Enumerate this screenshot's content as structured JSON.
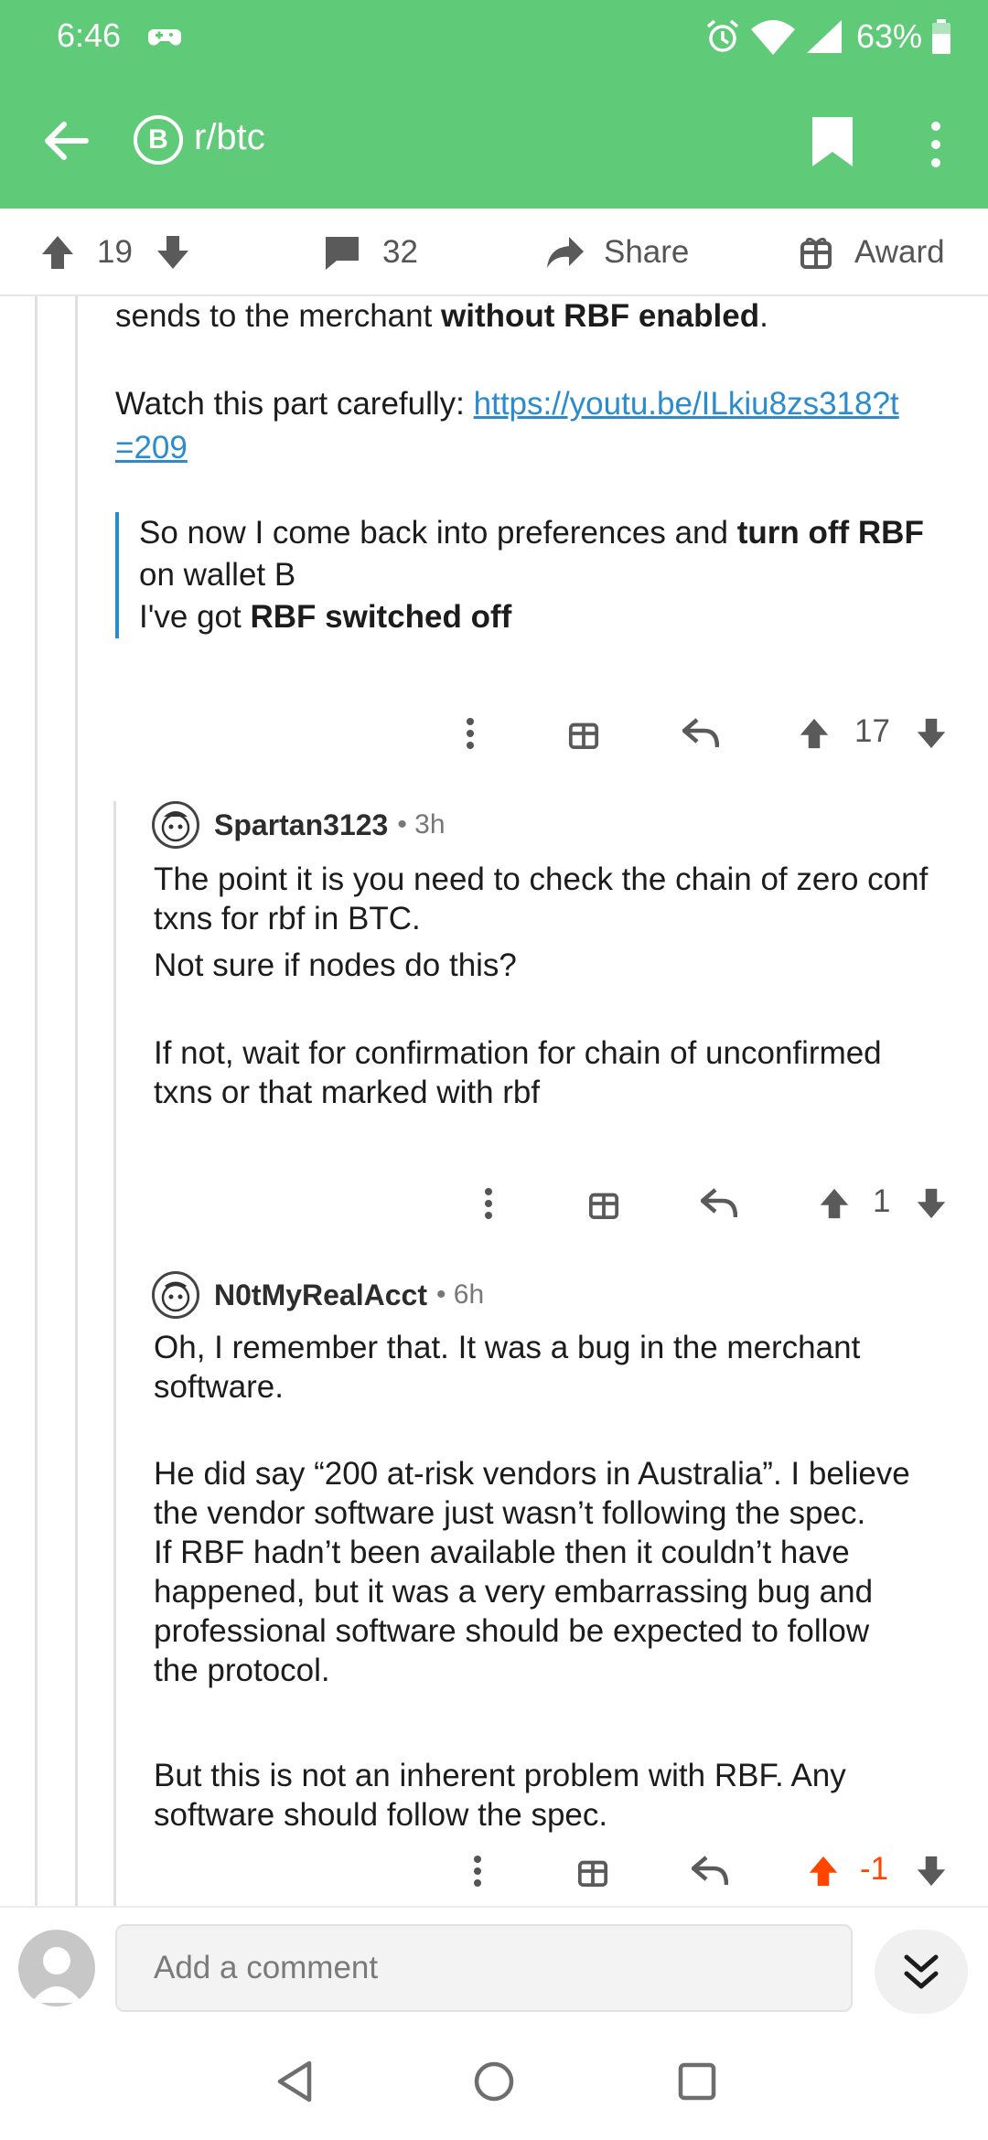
{
  "status_bar": {
    "time": "6:46",
    "battery": "63%"
  },
  "toolbar": {
    "subreddit": "r/btc",
    "subreddit_icon_letter": "B"
  },
  "action_bar": {
    "votes": "19",
    "comments": "32",
    "share_label": "Share",
    "award_label": "Award"
  },
  "comment1": {
    "line1_plain": "sends to the merchant ",
    "line1_bold": "without RBF enabled",
    "line1_end": ".",
    "watch_text": "Watch this part carefully: ",
    "link_line1": "https://youtu.be/ILkiu8zs318?t",
    "link_line2": "=209",
    "quote_l1_plain": "So now I come back into preferences and ",
    "quote_l1_bold": "turn off RBF",
    "quote_l2": "on wallet B",
    "quote_l3_plain": "I've got ",
    "quote_l3_bold": "RBF switched off",
    "score": "17"
  },
  "comment2": {
    "author": "Spartan3123",
    "time": "• 3h",
    "p1_l1": "The point it is you need to check the chain of zero conf",
    "p1_l2": "txns for rbf in BTC.",
    "p2": "Not sure if nodes do this?",
    "p3_l1": "If not, wait for confirmation for chain of unconfirmed",
    "p3_l2": "txns or that marked with rbf",
    "score": "1"
  },
  "comment3": {
    "author": "N0tMyRealAcct",
    "time": "• 6h",
    "p1_l1": "Oh, I remember that. It was a bug in the merchant",
    "p1_l2": "software.",
    "p2_l1": "He did say “200 at-risk vendors in Australia”. I believe",
    "p2_l2": "the vendor software just wasn’t following the spec.",
    "p2_l3": "If RBF hadn’t been available then it couldn’t have",
    "p2_l4": "happened, but it was a very embarrassing bug and",
    "p2_l5": "professional software should be expected to follow",
    "p2_l6": "the protocol.",
    "p3_l1": "But this is not an inherent problem with RBF. Any",
    "p3_l2": "software should follow the spec.",
    "score": "-1"
  },
  "comment_bar": {
    "placeholder": "Add a comment"
  },
  "colors": {
    "header": "#5fca78",
    "link": "#2a8ccf",
    "upvoted": "#ff4500"
  }
}
